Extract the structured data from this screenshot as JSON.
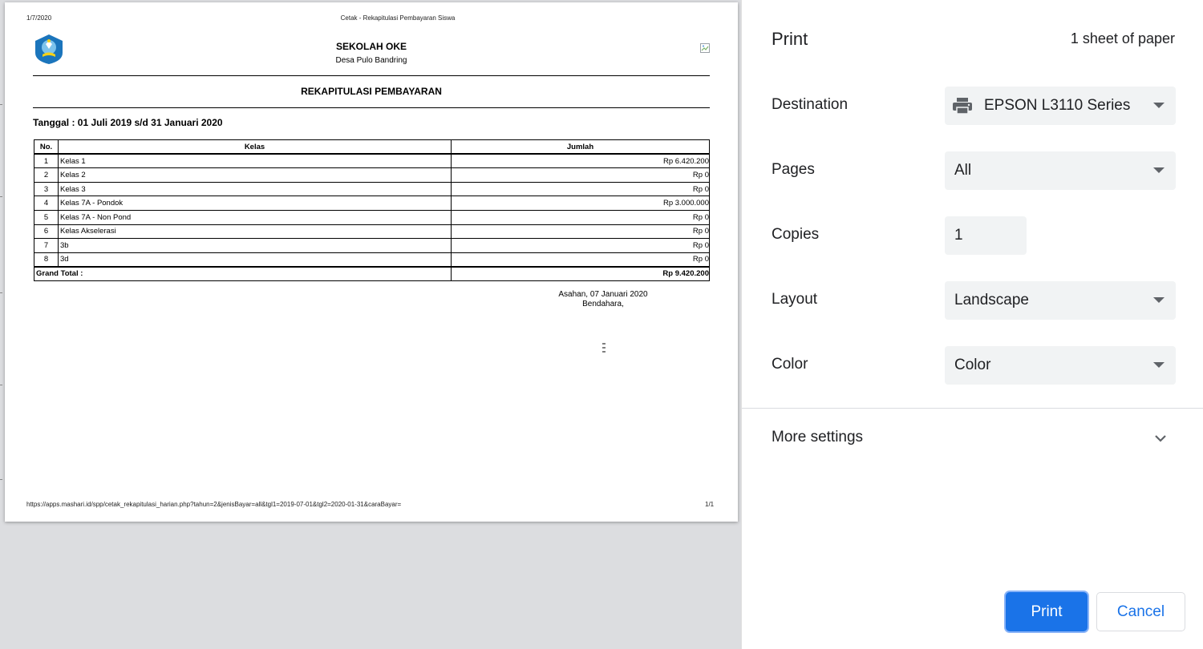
{
  "preview": {
    "header_date": "1/7/2020",
    "header_title": "Cetak - Rekapitulasi Pembayaran Siswa",
    "school_name": "SEKOLAH OKE",
    "school_address": "Desa Pulo Bandring",
    "report_title": "REKAPITULASI PEMBAYARAN",
    "date_range": "Tanggal : 01 Juli 2019 s/d 31 Januari 2020",
    "table": {
      "headers": {
        "no": "No.",
        "kelas": "Kelas",
        "jumlah": "Jumlah"
      },
      "rows": [
        {
          "no": "1",
          "kelas": "Kelas 1",
          "jumlah": "Rp 6.420.200"
        },
        {
          "no": "2",
          "kelas": "Kelas 2",
          "jumlah": "Rp 0"
        },
        {
          "no": "3",
          "kelas": "Kelas 3",
          "jumlah": "Rp 0"
        },
        {
          "no": "4",
          "kelas": "Kelas 7A - Pondok",
          "jumlah": "Rp 3.000.000"
        },
        {
          "no": "5",
          "kelas": "Kelas 7A - Non Pond",
          "jumlah": "Rp 0"
        },
        {
          "no": "6",
          "kelas": "Kelas Akselerasi",
          "jumlah": "Rp 0"
        },
        {
          "no": "7",
          "kelas": "3b",
          "jumlah": "Rp 0"
        },
        {
          "no": "8",
          "kelas": "3d",
          "jumlah": "Rp 0"
        }
      ],
      "grand_total_label": "Grand Total :",
      "grand_total_value": "Rp 9.420.200"
    },
    "signature_place_date": "Asahan, 07 Januari 2020",
    "signature_role": "Bendahara,",
    "footer_url": "https://apps.mashari.id/spp/cetak_rekapitulasi_harian.php?tahun=2&jenisBayar=all&tgl1=2019-07-01&tgl2=2020-01-31&caraBayar=",
    "footer_page": "1/1"
  },
  "panel": {
    "title": "Print",
    "sheet_count": "1 sheet of paper",
    "destination": {
      "label": "Destination",
      "value": "EPSON L3110 Series",
      "icon": "printer-icon"
    },
    "pages": {
      "label": "Pages",
      "value": "All"
    },
    "copies": {
      "label": "Copies",
      "value": "1"
    },
    "layout": {
      "label": "Layout",
      "value": "Landscape"
    },
    "color": {
      "label": "Color",
      "value": "Color"
    },
    "more_settings": "More settings",
    "print_button": "Print",
    "cancel_button": "Cancel"
  },
  "colors": {
    "accent": "#1a73e8",
    "select_bg": "#f1f3f4",
    "preview_bg": "#dcdde0"
  }
}
